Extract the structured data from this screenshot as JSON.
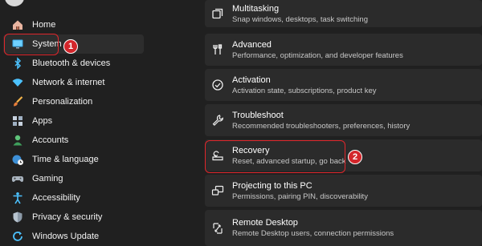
{
  "sidebar": {
    "items": [
      {
        "label": "Home",
        "icon": "home-icon",
        "selected": false
      },
      {
        "label": "System",
        "icon": "system-monitor-icon",
        "selected": true
      },
      {
        "label": "Bluetooth & devices",
        "icon": "bluetooth-icon",
        "selected": false
      },
      {
        "label": "Network & internet",
        "icon": "wifi-icon",
        "selected": false
      },
      {
        "label": "Personalization",
        "icon": "brush-icon",
        "selected": false
      },
      {
        "label": "Apps",
        "icon": "apps-icon",
        "selected": false
      },
      {
        "label": "Accounts",
        "icon": "accounts-icon",
        "selected": false
      },
      {
        "label": "Time & language",
        "icon": "globe-clock-icon",
        "selected": false
      },
      {
        "label": "Gaming",
        "icon": "gamepad-icon",
        "selected": false
      },
      {
        "label": "Accessibility",
        "icon": "accessibility-icon",
        "selected": false
      },
      {
        "label": "Privacy & security",
        "icon": "shield-icon",
        "selected": false
      },
      {
        "label": "Windows Update",
        "icon": "update-icon",
        "selected": false
      }
    ]
  },
  "settings": [
    {
      "title": "Multitasking",
      "subtitle": "Snap windows, desktops, task switching",
      "icon": "multitasking-icon"
    },
    {
      "title": "Advanced",
      "subtitle": "Performance, optimization, and developer features",
      "icon": "advanced-tools-icon"
    },
    {
      "title": "Activation",
      "subtitle": "Activation state, subscriptions, product key",
      "icon": "activation-check-icon"
    },
    {
      "title": "Troubleshoot",
      "subtitle": "Recommended troubleshooters, preferences, history",
      "icon": "wrench-icon"
    },
    {
      "title": "Recovery",
      "subtitle": "Reset, advanced startup, go back",
      "icon": "recovery-icon"
    },
    {
      "title": "Projecting to this PC",
      "subtitle": "Permissions, pairing PIN, discoverability",
      "icon": "projecting-icon"
    },
    {
      "title": "Remote Desktop",
      "subtitle": "Remote Desktop users, connection permissions",
      "icon": "remote-desktop-icon"
    }
  ],
  "annotations": {
    "step1": "1",
    "step2": "2",
    "highlight_color": "#e0262b"
  },
  "colors": {
    "background": "#202020",
    "card": "#2b2b2b",
    "selected": "#2d2d2d",
    "accent": "#4cc2ff"
  }
}
